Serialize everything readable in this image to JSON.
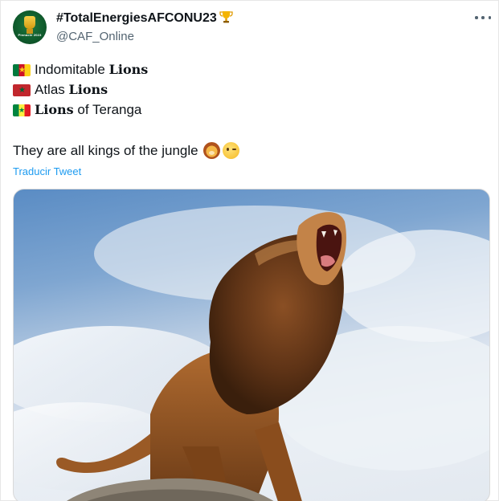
{
  "tweet": {
    "display_name": "#TotalEnergiesAFCONU23",
    "handle": "@CAF_Online",
    "avatar_text": "Pinnacle 2023",
    "more_icon": "more-horizontal-icon"
  },
  "lines": [
    {
      "flag": "cameroon-flag-icon",
      "pre": "Indomitable ",
      "bold": "Lions",
      "post": ""
    },
    {
      "flag": "morocco-flag-icon",
      "pre": "Atlas ",
      "bold": "Lions",
      "post": ""
    },
    {
      "flag": "senegal-flag-icon",
      "pre": "",
      "bold": "Lions",
      "post": " of Teranga"
    }
  ],
  "tagline": "They are all kings of the jungle",
  "tagline_emojis": [
    "lion-face-icon",
    "winking-face-icon"
  ],
  "translate_link": "Traducir Tweet",
  "media": {
    "description_icon": "roaring-lion-photo"
  }
}
